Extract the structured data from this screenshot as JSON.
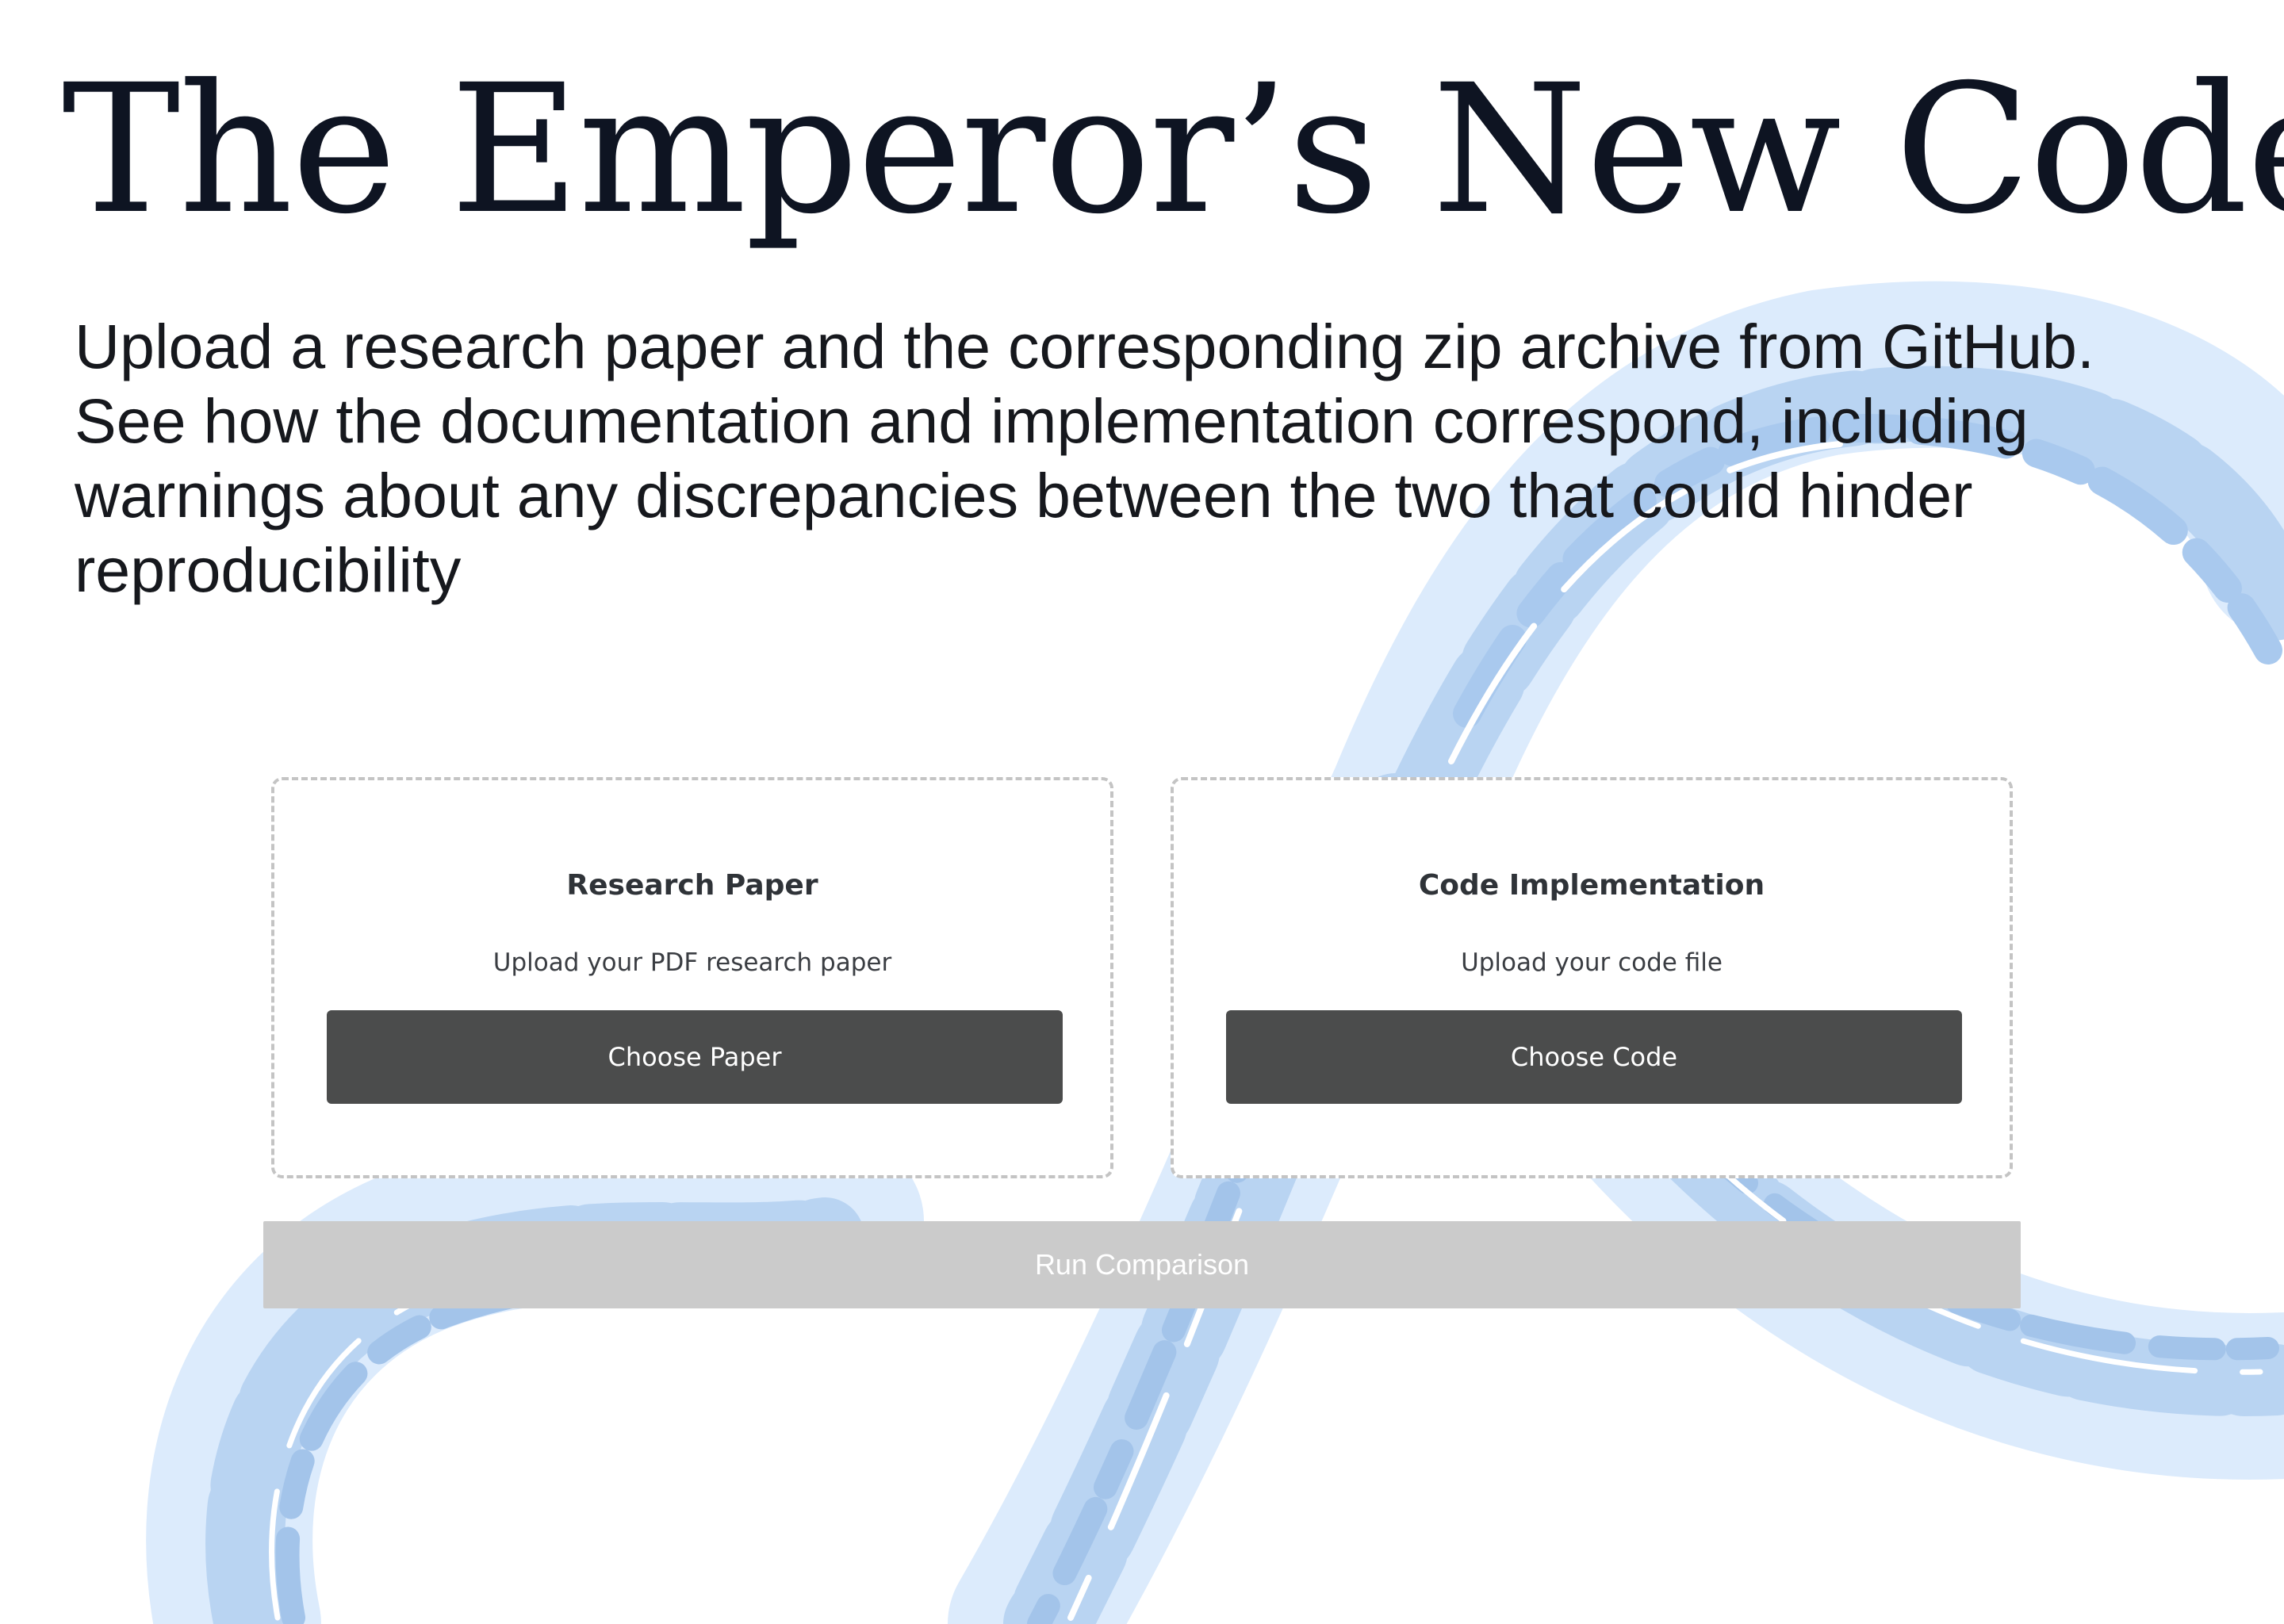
{
  "header": {
    "title": "The Emperor’s New Code",
    "description": "Upload a research paper and the corresponding zip archive from GitHub. See how the documentation and implementation correspond, including warnings about any discrepancies between the two that could hinder reproducibility"
  },
  "uploads": {
    "paper": {
      "title": "Research Paper",
      "description": "Upload your PDF research paper",
      "button_label": "Choose Paper"
    },
    "code": {
      "title": "Code Implementation",
      "description": "Upload your code file",
      "button_label": "Choose Code"
    }
  },
  "actions": {
    "run_label": "Run Comparison",
    "run_enabled": false
  },
  "background": {
    "icon": "infinity-brush-stroke-icon",
    "colors": [
      "#dcebfc",
      "#b9d4f2",
      "#a3c4ea"
    ]
  }
}
